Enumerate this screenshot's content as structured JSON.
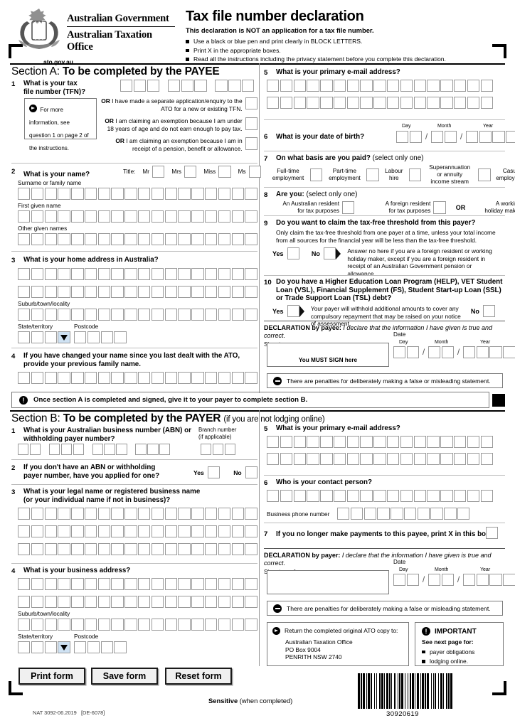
{
  "header": {
    "gov_line1": "Australian Government",
    "gov_line2": "Australian Taxation Office",
    "url": "ato.gov.au",
    "title": "Tax file number declaration",
    "subtitle": "This declaration is NOT an application for a tax file number.",
    "bullets": [
      "Use a black or blue pen and print clearly in BLOCK LETTERS.",
      "Print X in the appropriate boxes.",
      "Read all the instructions including the privacy statement before you complete this declaration."
    ]
  },
  "section_a": {
    "label": "Section A:",
    "heading": "To be completed by the PAYEE",
    "q1": {
      "num": "1",
      "title": "What is your tax\nfile number (TFN)?",
      "info": "For more information, see question 1 on page 2 of the instructions.",
      "or1_prefix": "OR",
      "or1": "I have made a separate application/enquiry to the ATO for a new or existing TFN.",
      "or2": "I am claiming an exemption because I am under 18 years of age and do not earn enough to pay tax.",
      "or3": "I am claiming an exemption because I am in receipt of a pension, benefit or allowance."
    },
    "q2": {
      "num": "2",
      "title": "What is your name?",
      "title_label": "Title:",
      "titles": [
        "Mr",
        "Mrs",
        "Miss",
        "Ms"
      ],
      "surname_label": "Surname or family name",
      "first_label": "First given name",
      "other_label": "Other given names"
    },
    "q3": {
      "num": "3",
      "title": "What is your home address in Australia?",
      "suburb_label": "Suburb/town/locality",
      "state_label": "State/territory",
      "postcode_label": "Postcode"
    },
    "q4": {
      "num": "4",
      "title": "If you have changed your name since you last dealt with the ATO,\nprovide your previous family name."
    },
    "q5": {
      "num": "5",
      "title": "What is your primary e-mail address?"
    },
    "q6": {
      "num": "6",
      "title": "What is your date of birth?",
      "day": "Day",
      "month": "Month",
      "year": "Year"
    },
    "q7": {
      "num": "7",
      "title": "On what basis are you paid?",
      "title_note": "(select only one)",
      "options": [
        "Full-time\nemployment",
        "Part-time\nemployment",
        "Labour\nhire",
        "Superannuation\nor annuity\nincome stream",
        "Casual\nemployment"
      ]
    },
    "q8": {
      "num": "8",
      "title": "Are you:",
      "title_note": "(select only one)",
      "opt1": "An Australian resident\nfor tax purposes",
      "opt2": "A foreign resident\nfor tax purposes",
      "or": "OR",
      "opt3": "A working\nholiday maker"
    },
    "q9": {
      "num": "9",
      "title": "Do you want to claim the tax-free threshold from this payer?",
      "body": "Only claim the tax-free threshold from one payer at a time, unless your total income from all sources for the financial year will be less than the tax-free threshold.",
      "yes": "Yes",
      "no": "No",
      "note": "Answer no here if you are a foreign resident or working holiday maker, except if you are a foreign resident in receipt of an Australian Government pension or allowance."
    },
    "q10": {
      "num": "10",
      "title": "Do you have a Higher Education Loan Program (HELP), VET Student Loan (VSL), Financial Supplement (FS), Student Start-up Loan (SSL) or Trade Support Loan (TSL) debt?",
      "yes": "Yes",
      "no": "No",
      "note": "Your payer will withhold additional amounts to cover any compulsory repayment that may be raised on your notice of assessment."
    },
    "declaration": {
      "bold": "DECLARATION by payee:",
      "italic": "I declare that the information I have given is true and correct.",
      "signature_label": "Signature",
      "must_sign": "You MUST SIGN here",
      "date_label": "Date",
      "day": "Day",
      "month": "Month",
      "year": "Year"
    },
    "penalty": "There are penalties for deliberately making a false or misleading statement.",
    "notice": "Once section A is completed and signed, give it to your payer to complete section B."
  },
  "section_b": {
    "label": "Section B:",
    "heading": "To be completed by the PAYER",
    "heading_note": "(if you are not lodging online)",
    "q1": {
      "num": "1",
      "title": "What is your Australian business number (ABN) or\nwithholding payer number?",
      "branch_label": "Branch number\n(if applicable)"
    },
    "q2": {
      "num": "2",
      "title": "If you don't have an ABN or withholding\npayer number, have you applied for one?",
      "yes": "Yes",
      "no": "No"
    },
    "q3": {
      "num": "3",
      "title": "What is your legal name or registered business name\n(or your individual name if not in business)?"
    },
    "q4": {
      "num": "4",
      "title": "What is your business address?",
      "suburb_label": "Suburb/town/locality",
      "state_label": "State/territory",
      "postcode_label": "Postcode"
    },
    "q5": {
      "num": "5",
      "title": "What is your primary e-mail address?"
    },
    "q6": {
      "num": "6",
      "title": "Who is your contact person?",
      "phone_label": "Business phone number"
    },
    "q7": {
      "num": "7",
      "title": "If you no longer make payments to this payee, print X in this box."
    },
    "declaration": {
      "bold": "DECLARATION by payer:",
      "italic": "I declare that the information I have given is true and correct.",
      "signature_label": "Signature of payer",
      "date_label": "Date",
      "day": "Day",
      "month": "Month",
      "year": "Year"
    },
    "penalty": "There are penalties for deliberately making a false or misleading statement.",
    "return_box": {
      "line1": "Return the completed original ATO copy to:",
      "line2": "Australian Taxation Office",
      "line3": "PO Box 9004",
      "line4": "PENRITH  NSW  2740"
    },
    "important_box": {
      "title": "IMPORTANT",
      "subtitle": "See next page for:",
      "items": [
        "payer obligations",
        "lodging online."
      ]
    }
  },
  "buttons": {
    "print": "Print form",
    "save": "Save form",
    "reset": "Reset form"
  },
  "footer": {
    "sensitive_bold": "Sensitive",
    "sensitive_rest": "(when completed)",
    "nat": "NAT 3092-06.2019",
    "de": "[DE-6078]",
    "barcode_number": "30920619"
  }
}
